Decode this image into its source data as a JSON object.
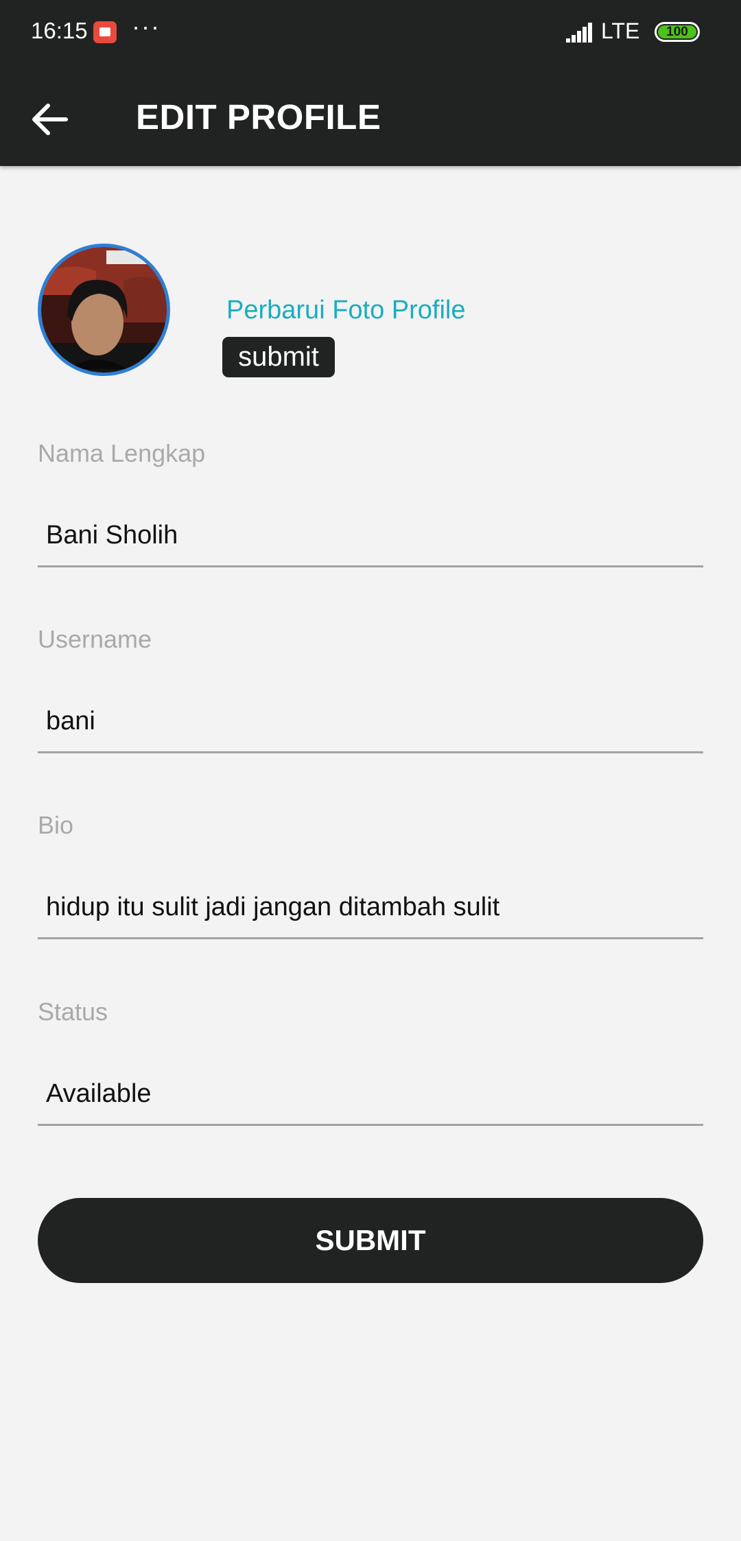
{
  "status_bar": {
    "time": "16:15",
    "more": "···",
    "network": "LTE",
    "battery": "100",
    "icons": [
      "youtube-notification-icon",
      "signal-icon",
      "battery-icon"
    ]
  },
  "app_bar": {
    "back_icon": "arrow-back-icon",
    "title": "EDIT PROFILE"
  },
  "profile_photo": {
    "avatar_icon": "avatar",
    "update_link": "Perbarui Foto Profile",
    "submit_label": "submit"
  },
  "form": {
    "fields": [
      {
        "label": "Nama Lengkap",
        "value": "Bani Sholih"
      },
      {
        "label": "Username",
        "value": "bani"
      },
      {
        "label": "Bio",
        "value": "hidup itu sulit jadi jangan ditambah sulit"
      },
      {
        "label": "Status",
        "value": "Available"
      }
    ],
    "submit_label": "SUBMIT"
  },
  "colors": {
    "bar_background": "#212222",
    "page_background": "#f3f3f3",
    "link": "#1aadbf",
    "avatar_border": "#2d7fd6",
    "battery": "#4cc21a"
  }
}
